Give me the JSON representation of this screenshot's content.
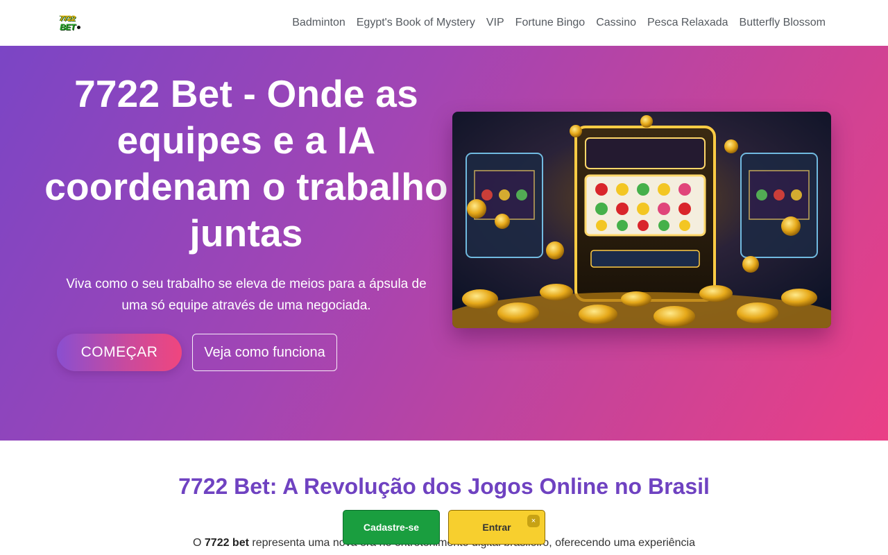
{
  "brand": {
    "logo_line1": "7722",
    "logo_line2": "BET"
  },
  "nav": {
    "items": [
      {
        "label": "Badminton"
      },
      {
        "label": "Egypt's Book of Mystery"
      },
      {
        "label": "VIP"
      },
      {
        "label": "Fortune Bingo"
      },
      {
        "label": "Cassino"
      },
      {
        "label": "Pesca Relaxada"
      },
      {
        "label": "Butterfly Blossom"
      }
    ]
  },
  "hero": {
    "title": "7722 Bet - Onde as equipes e a IA coordenam o trabalho juntas",
    "subtitle": "Viva como o seu trabalho se eleva de meios para a ápsula de uma só equipe através de uma negociada.",
    "primary_button": "COMEÇAR",
    "secondary_button": "Veja como funciona",
    "gradient_start": "#7b45c5",
    "gradient_end": "#ea3f86",
    "image_icon": "slot-machine-illustration"
  },
  "section": {
    "title": "7722 Bet: A Revolução dos Jogos Online no Brasil",
    "paragraph_prefix": "O ",
    "paragraph_bold": "7722 bet",
    "paragraph_rest": " representa uma nova era no entretenimento digital brasileiro, oferecendo uma experiência",
    "title_color": "#6f42c1"
  },
  "cta_bar": {
    "register_label": "Cadastre-se",
    "login_label": "Entrar",
    "close_label": "×",
    "register_color": "#1a9e3f",
    "login_color": "#f7cf2e"
  }
}
